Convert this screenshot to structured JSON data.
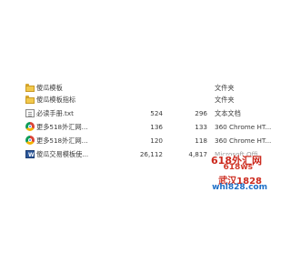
{
  "files": [
    {
      "name": "傻瓜模板",
      "size": "",
      "packed": "",
      "type": "文件夹",
      "icon": "folder-icon"
    },
    {
      "name": "傻瓜模板指标",
      "size": "",
      "packed": "",
      "type": "文件夹",
      "icon": "folder-icon"
    },
    {
      "name": "必读手册.txt",
      "size": "524",
      "packed": "296",
      "type": "文本文档",
      "icon": "text-file-icon"
    },
    {
      "name": "更多518外汇网...",
      "size": "136",
      "packed": "133",
      "type": "360 Chrome HT...",
      "icon": "chrome-html-icon"
    },
    {
      "name": "更多518外汇网...",
      "size": "120",
      "packed": "118",
      "type": "360 Chrome HT...",
      "icon": "chrome-html-icon"
    },
    {
      "name": "傻瓜交易模板使...",
      "size": "26,112",
      "packed": "4,817",
      "type": "Microsoft Offi...",
      "icon": "word-doc-icon"
    }
  ],
  "watermark": {
    "line1": "618外汇网",
    "line2": "618ws",
    "line3": "武汉1828",
    "line4": "whl828.com"
  }
}
